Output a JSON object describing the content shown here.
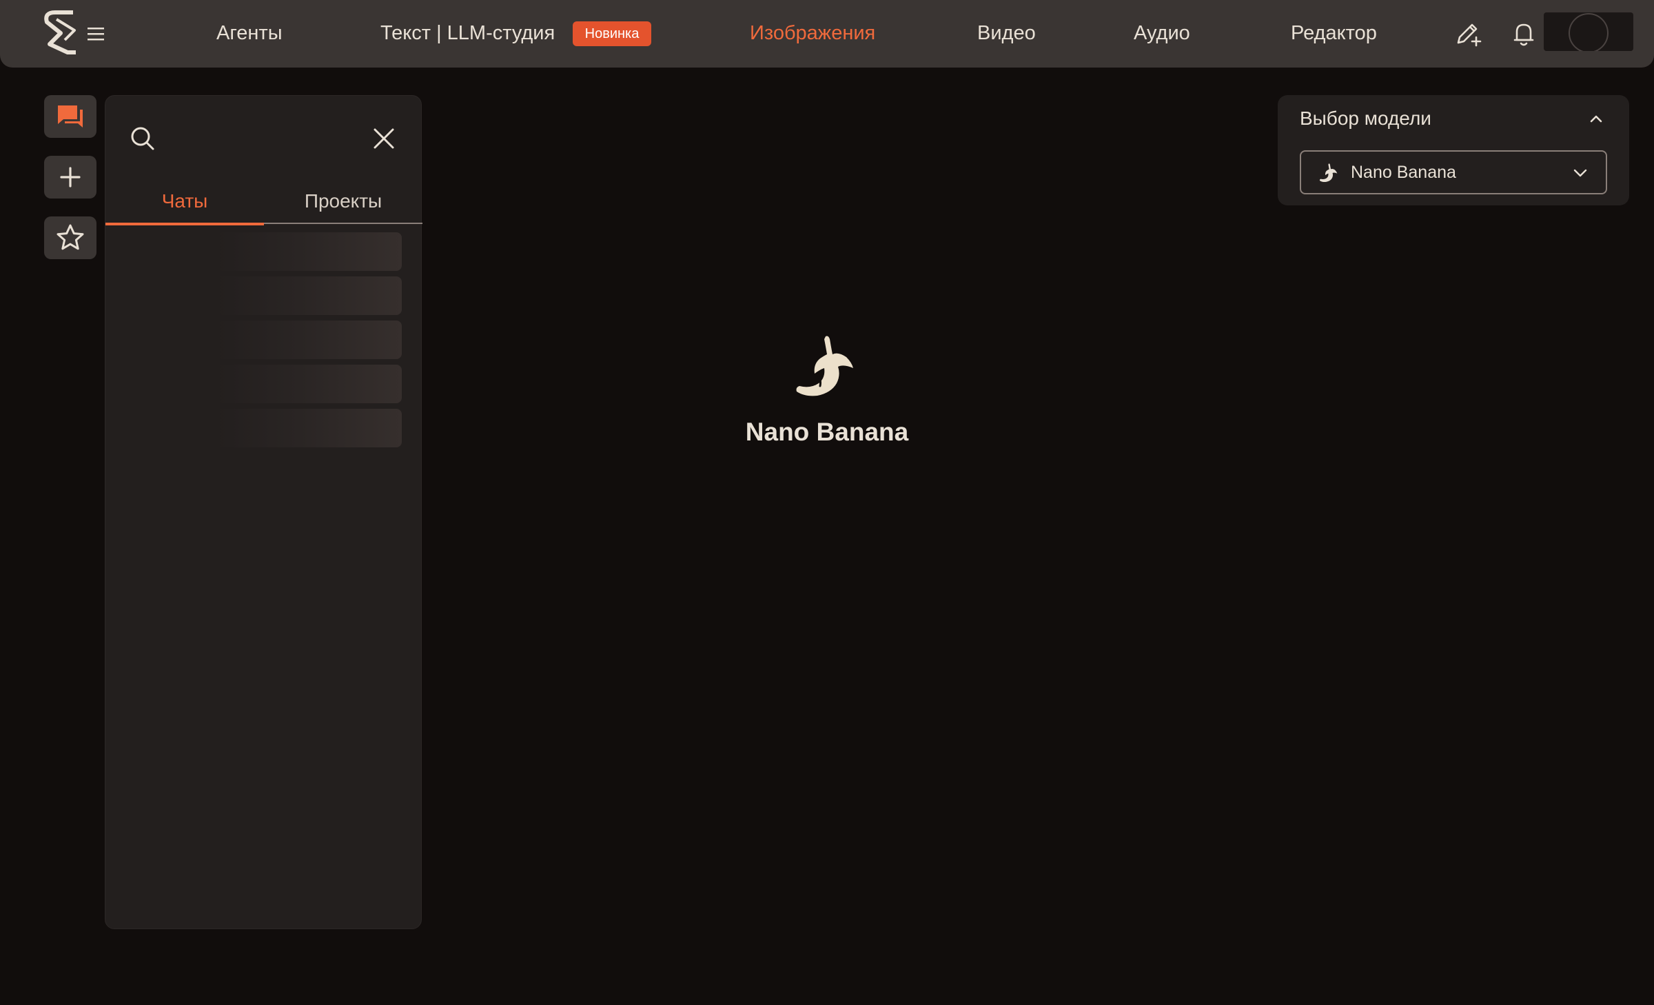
{
  "colors": {
    "accent": "#f06a3c",
    "badge": "#e4532d",
    "background": "#110d0c",
    "surface": "#231f1e",
    "topbar": "#3a3533",
    "text": "#e9e1d6"
  },
  "topbar": {
    "logo_icon": "brand-logo-icon",
    "menu_icon": "hamburger-icon",
    "nav": [
      {
        "label": "Агенты",
        "active": false
      },
      {
        "label": "Текст | LLM-студия",
        "active": false
      },
      {
        "label": "Изображения",
        "active": true
      },
      {
        "label": "Видео",
        "active": false
      },
      {
        "label": "Аудио",
        "active": false
      },
      {
        "label": "Редактор",
        "active": false
      }
    ],
    "new_badge": "Новинка",
    "icons": [
      "pencil-sparkle-icon",
      "bell-icon",
      "avatar"
    ]
  },
  "rail": {
    "items": [
      {
        "icon": "chat-icon",
        "active": true
      },
      {
        "icon": "plus-icon",
        "active": false
      },
      {
        "icon": "star-icon",
        "active": false
      }
    ]
  },
  "chats_panel": {
    "search_placeholder": "",
    "tabs": [
      {
        "label": "Чаты",
        "active": true
      },
      {
        "label": "Проекты",
        "active": false
      }
    ],
    "loading_rows": 5
  },
  "main": {
    "model_icon": "banana-icon",
    "model_name": "Nano Banana"
  },
  "model_selector": {
    "title": "Выбор модели",
    "selected": "Nano Banana",
    "selected_icon": "banana-icon"
  }
}
